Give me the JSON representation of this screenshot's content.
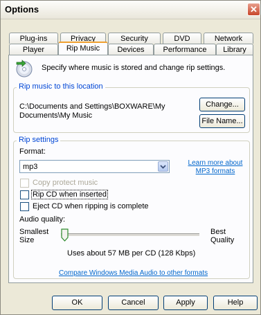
{
  "window": {
    "title": "Options",
    "close_glyph": "✕"
  },
  "tabs_back": [
    "Plug-ins",
    "Privacy",
    "Security",
    "DVD",
    "Network"
  ],
  "tabs_front": [
    "Player",
    "Rip Music",
    "Devices",
    "Performance",
    "Library"
  ],
  "active_tab": "Rip Music",
  "header": {
    "description": "Specify where music is stored and change rip settings.",
    "icon": "cd-rip-icon"
  },
  "location": {
    "group_label": "Rip music to this location",
    "path_line1": "C:\\Documents and Settings\\BOXWARE\\My",
    "path_line2": "Documents\\My Music",
    "change_button": "Change...",
    "filename_button": "File Name..."
  },
  "rip_settings": {
    "group_label": "Rip settings",
    "format_label": "Format:",
    "format_value": "mp3",
    "learn_more_line1": "Learn more about",
    "learn_more_line2": "MP3 formats",
    "copy_protect": {
      "label": "Copy protect music",
      "checked": false,
      "disabled": true
    },
    "rip_when_inserted": {
      "label": "Rip CD when inserted",
      "checked": false
    },
    "eject_when_complete": {
      "label": "Eject CD when ripping is complete",
      "checked": false
    },
    "audio_quality_label": "Audio quality:",
    "smallest_line1": "Smallest",
    "smallest_line2": "Size",
    "best_line1": "Best",
    "best_line2": "Quality",
    "slider_level": 0.0,
    "usage_text": "Uses about 57 MB per CD (128 Kbps)",
    "compare_link": "Compare Windows Media Audio to other formats"
  },
  "buttons": {
    "ok": "OK",
    "cancel": "Cancel",
    "apply": "Apply",
    "help": "Help"
  },
  "colors": {
    "group_label": "#0046d5",
    "link": "#0066cc",
    "tab_highlight": "#f0a030",
    "close_button": "#c8462a"
  }
}
